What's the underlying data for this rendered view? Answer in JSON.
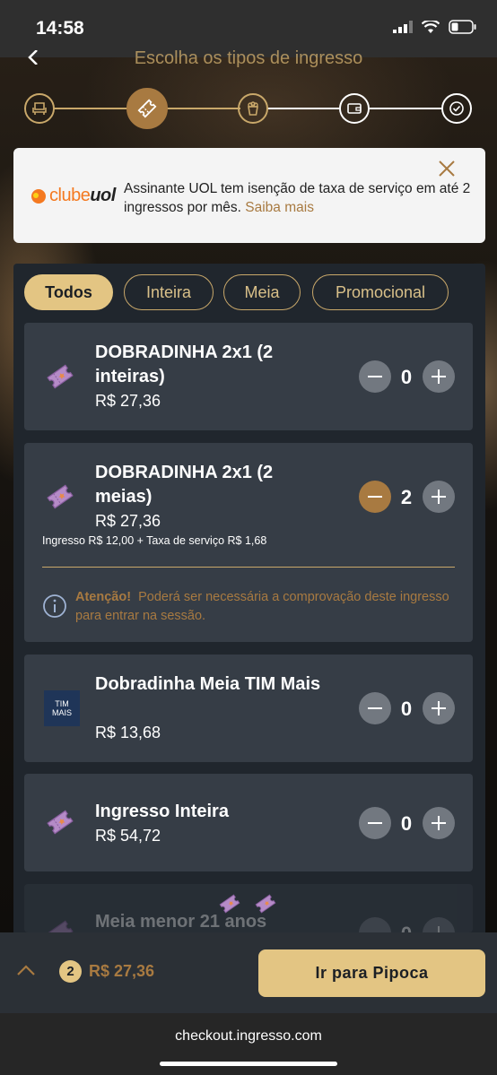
{
  "status": {
    "time": "14:58"
  },
  "header": {
    "title": "Escolha os tipos de ingresso"
  },
  "banner": {
    "logo_text_1": "clube",
    "logo_text_2": "uol",
    "message": "Assinante UOL tem isenção de taxa de serviço em até 2 ingressos por mês.",
    "link": "Saiba mais"
  },
  "filters": [
    "Todos",
    "Inteira",
    "Meia",
    "Promocional"
  ],
  "tickets": [
    {
      "name": "DOBRADINHA 2x1 (2 inteiras)",
      "price": "R$ 27,36",
      "qty": "0"
    },
    {
      "name": "DOBRADINHA 2x1 (2 meias)",
      "price": "R$ 27,36",
      "qty": "2",
      "fee": "Ingresso R$ 12,00 + Taxa de serviço R$ 1,68",
      "notice_title": "Atenção!",
      "notice_text": "Poderá ser necessária a comprovação deste ingresso para entrar na sessão."
    },
    {
      "name": "Dobradinha Meia TIM Mais",
      "price": "R$ 13,68",
      "qty": "0",
      "logo_line1": "TIM",
      "logo_line2": "MAIS"
    },
    {
      "name": "Ingresso Inteira",
      "price": "R$ 54,72",
      "qty": "0"
    },
    {
      "name": "Meia menor 21 anos",
      "qty": "0"
    }
  ],
  "cart": {
    "count": "2",
    "total": "R$ 27,36"
  },
  "cta": {
    "label": "Ir para Pipoca"
  },
  "browser": {
    "url": "checkout.ingresso.com"
  },
  "colors": {
    "accent": "#c9a86a",
    "accent_dark": "#a87a41",
    "card": "#363d46",
    "panel": "#20262d"
  }
}
